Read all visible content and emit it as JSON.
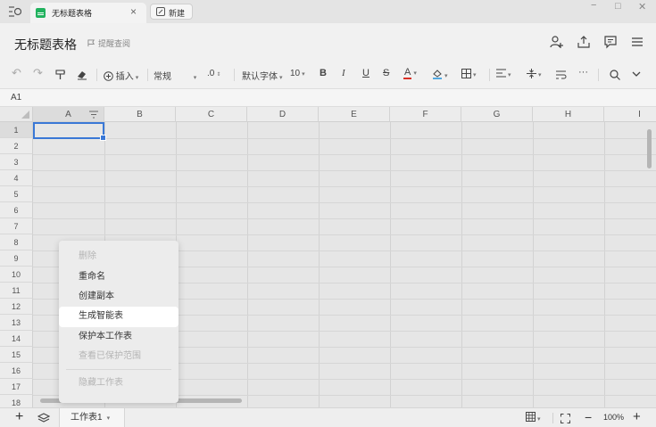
{
  "window": {
    "tab_title": "无标题表格",
    "new_tab_label": "新建",
    "close_glyph": "×",
    "minimize_glyph": "−",
    "maximize_glyph": "□",
    "window_close_glyph": "✕"
  },
  "header": {
    "doc_title": "无标题表格",
    "remind_label": "提醒查阅"
  },
  "toolbar": {
    "undo": "↶",
    "redo": "↷",
    "insert_label": "插入",
    "number_format": "常规",
    "decimal": ".0",
    "font_family": "默认字体",
    "font_size": "10",
    "bold": "B",
    "italic": "I",
    "underline": "U",
    "strike": "S",
    "font_color_letter": "A",
    "more": "···"
  },
  "formula_bar": {
    "cell_ref": "A1"
  },
  "grid": {
    "columns": [
      "A",
      "B",
      "C",
      "D",
      "E",
      "F",
      "G",
      "H",
      "I"
    ],
    "rows": [
      "1",
      "2",
      "3",
      "4",
      "5",
      "6",
      "7",
      "8",
      "9",
      "10",
      "11",
      "12",
      "13",
      "14",
      "15",
      "16",
      "17",
      "18"
    ]
  },
  "context_menu": {
    "items": [
      {
        "label": "删除",
        "disabled": true
      },
      {
        "label": "重命名",
        "disabled": false
      },
      {
        "label": "创建副本",
        "disabled": false
      },
      {
        "label": "生成智能表",
        "disabled": false,
        "highlighted": true
      },
      {
        "label": "保护本工作表",
        "disabled": false
      },
      {
        "label": "查看已保护范围",
        "disabled": true
      },
      {
        "label": "隐藏工作表",
        "disabled": true
      }
    ]
  },
  "bottom": {
    "add": "+",
    "sheet_name": "工作表1",
    "zoom_minus": "−",
    "zoom": "100%",
    "zoom_plus": "+"
  },
  "colors": {
    "accent_blue": "#3a78d6",
    "sheet_green": "#21b25e"
  }
}
